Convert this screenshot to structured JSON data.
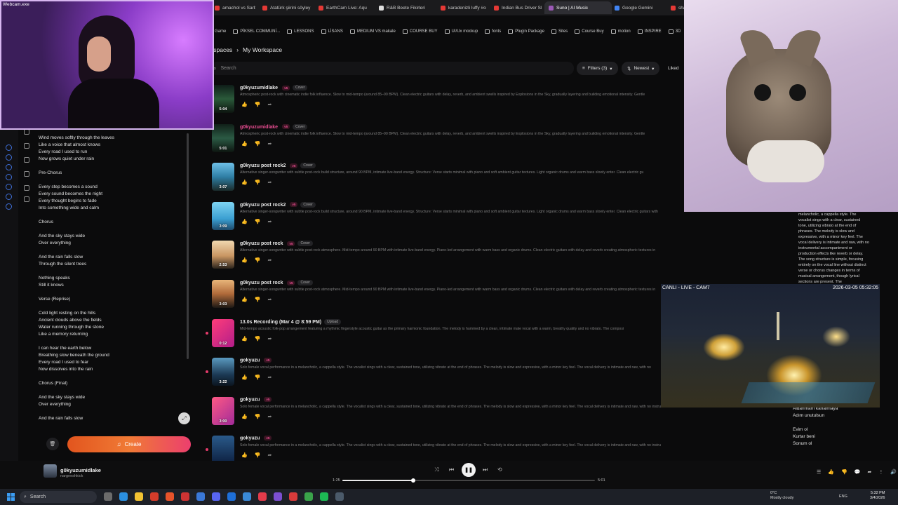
{
  "browser": {
    "tabs": [
      {
        "label": "Webcam.exe"
      },
      {
        "label": "amachol vs Sarbick"
      },
      {
        "label": "Atatürk şiirini söyley"
      },
      {
        "label": "EarthCam Live: Aqu"
      },
      {
        "label": "R&B Beete Fikirleri"
      },
      {
        "label": "karadenizli luffy #o"
      },
      {
        "label": "Indian Bus Driver Sh"
      },
      {
        "label": "Suno | AI Music"
      },
      {
        "label": "Google Gemini"
      },
      {
        "label": "sha"
      }
    ],
    "bookmarks": [
      "Game",
      "PİKSEL COMMUNİ...",
      "LESSONS",
      "LİSANS",
      "MEDIUM VS makale",
      "COURSE BUY",
      "UI/Ux mockup",
      "fonts",
      "Plugin Package",
      "Sites",
      "Course Buy",
      "motion",
      "INSPIRE",
      "3D"
    ]
  },
  "header": {
    "breadcrumb_parent": "kspaces",
    "breadcrumb_sep": "›",
    "breadcrumb_current": "My Workspace",
    "search_placeholder": "Search",
    "filters_label": "Filters (3)",
    "sort_label": "Newest",
    "liked_label": "Liked"
  },
  "lyrics": [
    [
      "Wind moves softly through the leaves",
      "Like a voice that almost knows",
      "Every road I used to run",
      "Now grows quiet under rain"
    ],
    [
      "Pre-Chorus"
    ],
    [
      "Every step becomes a sound",
      "Every sound becomes the night",
      "Every thought begins to fade",
      "Into something wide and calm"
    ],
    [
      "Chorus"
    ],
    [
      "And the sky stays wide",
      "Over everything"
    ],
    [
      "And the rain falls slow",
      "Through the silent trees"
    ],
    [
      "Nothing speaks",
      "Still it knows"
    ],
    [
      "Verse (Reprise)"
    ],
    [
      "Cold light resting on the hills",
      "Ancient clouds above the fields",
      "Water running through the stone",
      "Like a memory returning"
    ],
    [
      "I can hear the earth below",
      "Breathing slow beneath the ground",
      "Every road I used to fear",
      "Now dissolves into the rain"
    ],
    [
      "Chorus (Final)"
    ],
    [
      "And the sky stays wide",
      "Over everything"
    ],
    [
      "And the rain falls slow"
    ]
  ],
  "create_label": "Create",
  "songs": [
    {
      "title": "g0kyuzumidlake",
      "version": "v5",
      "tag": "Cover",
      "duration": "5:04",
      "highlight": false,
      "new": false,
      "desc": "Atmospheric post-rock with cinematic indie folk influence. Slow to mid-tempo (around 85–90 BPM). Clean electric guitars with delay, reverb, and ambient swells inspired by Explosions in the Sky, gradually layering and building emotional intensity. Gentle"
    },
    {
      "title": "g0kyuzumidlake",
      "version": "v5",
      "tag": "Cover",
      "duration": "5:01",
      "highlight": true,
      "new": false,
      "desc": "Atmospheric post-rock with cinematic indie folk influence. Slow to mid-tempo (around 85–90 BPM). Clean electric guitars with delay, reverb, and ambient swells inspired by Explosions in the Sky, gradually layering and building emotional intensity. Gentle"
    },
    {
      "title": "g0kyuzu post rock2",
      "version": "v5",
      "tag": "Cover",
      "duration": "3:07",
      "highlight": false,
      "new": false,
      "desc": "Alternative singer-songwriter with subtle post-rock build structure, around 90 BPM, intimate live-band energy. Structure: Verse starts minimal with piano and soft ambient guitar textures. Light organic drums and warm bass slowly enter. Clean electric gu"
    },
    {
      "title": "g0kyuzu post rock2",
      "version": "v5",
      "tag": "Cover",
      "duration": "3:09",
      "highlight": false,
      "new": false,
      "desc": "Alternative singer-songwriter with subtle post-rock build structure, around 90 BPM, intimate live-band energy. Structure: Verse starts minimal with piano and soft ambient guitar textures. Light organic drums and warm bass slowly enter. Clean electric guitars with"
    },
    {
      "title": "g0kyuzu post rock",
      "version": "v5",
      "tag": "Cover",
      "duration": "2:53",
      "highlight": false,
      "new": false,
      "desc": "Alternative singer-songwriter with subtle post-rock atmosphere. Mid-tempo around 90 BPM with intimate live-band energy. Piano-led arrangement with warm bass and organic drums. Clean electric guitars with delay and reverb creating atmospheric textures in"
    },
    {
      "title": "g0kyuzu post rock",
      "version": "v5",
      "tag": "Cover",
      "duration": "3:03",
      "highlight": false,
      "new": false,
      "desc": "Alternative singer-songwriter with subtle post-rock atmosphere. Mid-tempo around 90 BPM with intimate live-band energy. Piano-led arrangement with warm bass and organic drums. Clean electric guitars with delay and reverb creating atmospheric textures in"
    },
    {
      "title": "13.0s Recording (Mar 4 @ 8:59 PM)",
      "version": "",
      "tag": "Upload",
      "duration": "0:12",
      "highlight": false,
      "new": true,
      "desc": "Mid-tempo acoustic folk-pop arrangement featuring a rhythmic fingerstyle acoustic guitar as the primary harmonic foundation. The melody is hummed by a clean, intimate male vocal with a warm, breathy quality and no vibrato. The composi"
    },
    {
      "title": "gokyuzu",
      "version": "v5",
      "tag": "",
      "duration": "3:22",
      "highlight": false,
      "new": true,
      "desc": "Solo female vocal performance in a melancholic, a cappella style. The vocalist sings with a clear, sustained tone, utilizing vibrato at the end of phrases. The melody is slow and expressive, with a minor key feel. The vocal delivery is intimate and raw, with no"
    },
    {
      "title": "gokyuzu",
      "version": "v5",
      "tag": "",
      "duration": "3:00",
      "highlight": false,
      "new": false,
      "desc": "Solo female vocal performance in a melancholic, a cappella style. The vocalist sings with a clear, sustained tone, utilizing vibrato at the end of phrases. The melody is slow and expressive, with a minor key feel. The vocal delivery is intimate and raw, with no instru"
    },
    {
      "title": "gokyuzu",
      "version": "v5",
      "tag": "",
      "duration": "",
      "highlight": false,
      "new": true,
      "desc": "Solo female vocal performance in a melancholic, a cappella style. The vocalist sings with a clear, sustained tone, utilizing vibrato at the end of phrases. The melody is slow and expressive, with a minor key feel. The vocal delivery is intimate and raw, with no instru"
    }
  ],
  "right_panel_text": "melancholic, a cappella style. The vocalist sings with a clear, sustained tone, utilizing vibrato at the end of phrases. The melody is slow and expressive, with a minor key feel. The vocal delivery is intimate and raw, with no instrumental accompaniment or production effects like reverb or delay. The song structure is simple, focusing entirely on the vocal line without distinct verse or chorus changes in terms of musical arrangement, though lyrical sections are present. The",
  "right_lyrics": [
    "Aldanmam kanalmaya",
    "Adım unutulsun",
    "",
    "Evim ol",
    "Kurtar beni",
    "Sonum ol"
  ],
  "livecam": {
    "label": "CANLI - LIVE - CAM7",
    "timestamp": "2026-03-05 05:32:05"
  },
  "player": {
    "title": "g0kyuzumidlake",
    "artist": "nargeeshkick",
    "current_time": "1:25",
    "total_time": "5:01",
    "progress": 0.28
  },
  "taskbar": {
    "search_label": "Search",
    "weather_temp": "0°C",
    "weather_desc": "Mostly cloudy",
    "lang": "ENG",
    "time": "5:32 PM",
    "date": "3/4/2026"
  }
}
